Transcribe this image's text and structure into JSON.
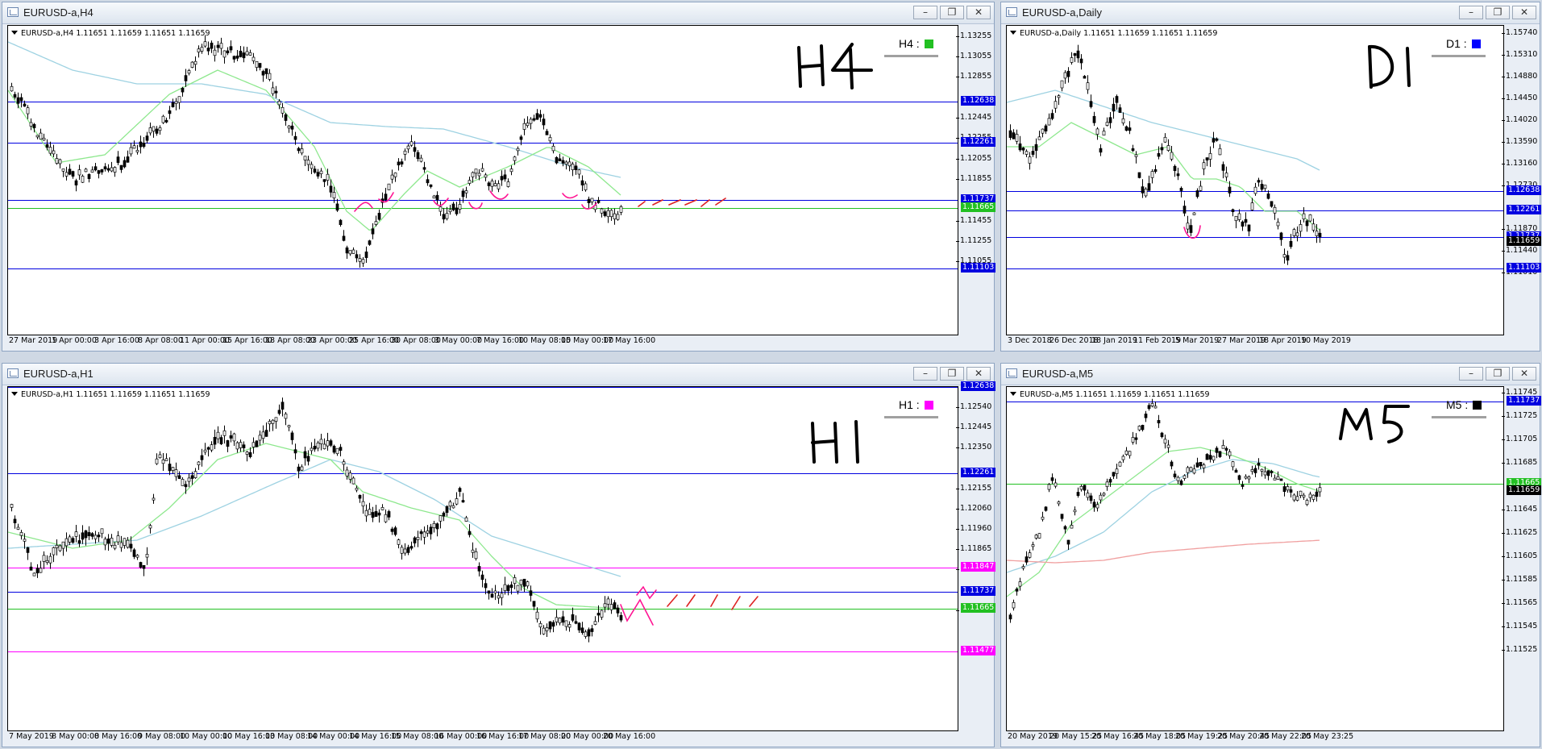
{
  "windows": [
    {
      "id": "h4",
      "title": "EURUSD-a,H4",
      "symbol_line": "EURUSD-a,H4  1.11651 1.11659 1.11651 1.11659",
      "tf_label": "H4 :",
      "tf_color": "#22c022",
      "handwritten": "H4",
      "price_ticks": [
        "1.13255",
        "1.13055",
        "1.12855",
        "1.12445",
        "1.12255",
        "1.12055",
        "1.11855",
        "1.11455",
        "1.11255",
        "1.11055"
      ],
      "time_ticks": [
        "27 Mar 2019",
        "1 Apr 00:00",
        "3 Apr 16:00",
        "8 Apr 08:00",
        "11 Apr 00:00",
        "15 Apr 16:00",
        "18 Apr 08:00",
        "23 Apr 00:00",
        "25 Apr 16:00",
        "30 Apr 08:00",
        "3 May 00:00",
        "7 May 16:00",
        "10 May 08:00",
        "15 May 00:00",
        "17 May 16:00"
      ],
      "price_labels": [
        {
          "text": "1.12638",
          "color": "#0000e0"
        },
        {
          "text": "1.12261",
          "color": "#0000e0"
        },
        {
          "text": "1.11737",
          "color": "#0000e0"
        },
        {
          "text": "1.11665",
          "color": "#22c022"
        },
        {
          "text": "1.11103",
          "color": "#0000e0"
        }
      ]
    },
    {
      "id": "d1",
      "title": "EURUSD-a,Daily",
      "symbol_line": "EURUSD-a,Daily  1.11651 1.11659 1.11651 1.11659",
      "tf_label": "D1 :",
      "tf_color": "#0000ff",
      "handwritten": "D1",
      "price_ticks": [
        "1.15740",
        "1.15310",
        "1.14880",
        "1.14450",
        "1.14020",
        "1.13590",
        "1.13160",
        "1.12730",
        "1.11870",
        "1.11440",
        "1.11010"
      ],
      "time_ticks": [
        "3 Dec 2018",
        "26 Dec 2018",
        "18 Jan 2019",
        "11 Feb 2019",
        "5 Mar 2019",
        "27 Mar 2019",
        "18 Apr 2019",
        "10 May 2019"
      ],
      "price_labels": [
        {
          "text": "1.12638",
          "color": "#0000e0"
        },
        {
          "text": "1.12261",
          "color": "#0000e0"
        },
        {
          "text": "1.11737",
          "color": "#0000e0"
        },
        {
          "text": "1.11659",
          "color": "#000000"
        },
        {
          "text": "1.11103",
          "color": "#0000e0"
        }
      ]
    },
    {
      "id": "h1",
      "title": "EURUSD-a,H1",
      "symbol_line": "EURUSD-a,H1  1.11651 1.11659 1.11651 1.11659",
      "tf_label": "H1 :",
      "tf_color": "#ff00ff",
      "handwritten": "H1",
      "price_ticks": [
        "1.12540",
        "1.12445",
        "1.12350",
        "1.12155",
        "1.12060",
        "1.11960",
        "1.11865",
        "1.11770",
        "1.11575"
      ],
      "time_ticks": [
        "7 May 2019",
        "8 May 00:00",
        "8 May 16:00",
        "9 May 08:00",
        "10 May 00:00",
        "10 May 16:00",
        "13 May 08:00",
        "14 May 00:00",
        "14 May 16:00",
        "15 May 08:00",
        "16 May 00:00",
        "16 May 16:00",
        "17 May 08:00",
        "20 May 00:00",
        "20 May 16:00"
      ],
      "price_labels": [
        {
          "text": "1.12638",
          "color": "#0000e0"
        },
        {
          "text": "1.12261",
          "color": "#0000e0"
        },
        {
          "text": "1.11847",
          "color": "#ff00ff"
        },
        {
          "text": "1.11737",
          "color": "#0000e0"
        },
        {
          "text": "1.11665",
          "color": "#22c022"
        },
        {
          "text": "1.11477",
          "color": "#ff00ff"
        }
      ]
    },
    {
      "id": "m5",
      "title": "EURUSD-a,M5",
      "symbol_line": "EURUSD-a,M5  1.11651 1.11659 1.11651 1.11659",
      "tf_label": "M5 :",
      "tf_color": "#000000",
      "handwritten": "M5",
      "price_ticks": [
        "1.11745",
        "1.11725",
        "1.11705",
        "1.11685",
        "1.11645",
        "1.11625",
        "1.11605",
        "1.11585",
        "1.11565",
        "1.11545",
        "1.11525"
      ],
      "time_ticks": [
        "20 May 2019",
        "20 May 15:25",
        "20 May 16:45",
        "20 May 18:05",
        "20 May 19:25",
        "20 May 20:45",
        "20 May 22:05",
        "20 May 23:25"
      ],
      "price_labels": [
        {
          "text": "1.11737",
          "color": "#0000e0"
        },
        {
          "text": "1.11665",
          "color": "#22c022"
        },
        {
          "text": "1.11659",
          "color": "#000000"
        }
      ]
    }
  ],
  "window_buttons": {
    "minimize": "–",
    "restore": "❐",
    "close": "✕"
  }
}
